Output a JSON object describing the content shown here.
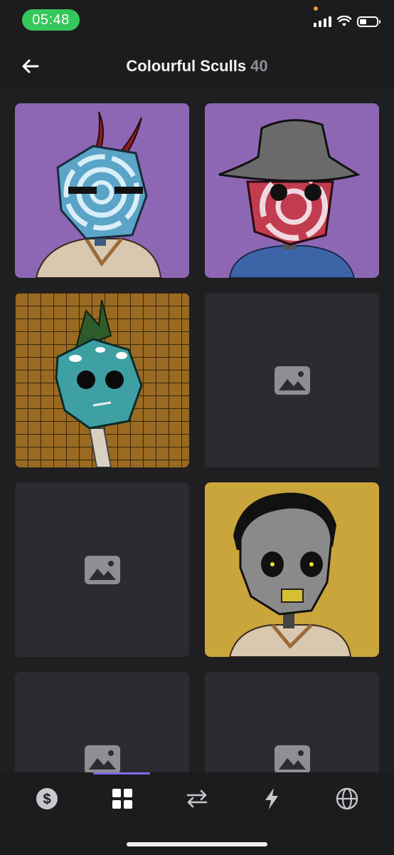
{
  "status": {
    "time": "05:48"
  },
  "header": {
    "title": "Colourful Sculls",
    "count": "40"
  },
  "grid": {
    "items": [
      {
        "kind": "image",
        "icon": "skull-horns-art"
      },
      {
        "kind": "image",
        "icon": "skull-bucket-hat-art"
      },
      {
        "kind": "image",
        "icon": "skull-mohawk-art"
      },
      {
        "kind": "placeholder",
        "icon": "image-placeholder-icon"
      },
      {
        "kind": "placeholder",
        "icon": "image-placeholder-icon"
      },
      {
        "kind": "image",
        "icon": "skull-curly-hair-art"
      },
      {
        "kind": "placeholder",
        "icon": "image-placeholder-icon"
      },
      {
        "kind": "placeholder",
        "icon": "image-placeholder-icon"
      }
    ]
  },
  "tabbar": {
    "active_index": 1,
    "tabs": [
      {
        "icon": "dollar-circle-icon"
      },
      {
        "icon": "grid-icon"
      },
      {
        "icon": "swap-arrows-icon"
      },
      {
        "icon": "lightning-icon"
      },
      {
        "icon": "globe-icon"
      }
    ]
  },
  "colors": {
    "accent": "#7c6cf0",
    "status_green": "#35c759",
    "background": "#1f1f21",
    "tile": "#2c2c30"
  }
}
